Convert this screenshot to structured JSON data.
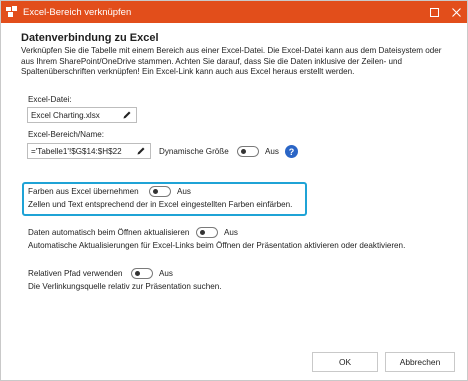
{
  "window": {
    "title": "Excel-Bereich verknüpfen",
    "accent_color": "#e24e1b"
  },
  "section": {
    "heading": "Datenverbindung zu Excel",
    "description": "Verknüpfen Sie die Tabelle mit einem Bereich aus einer Excel-Datei. Die Excel-Datei kann aus dem Dateisystem oder aus Ihrem SharePoint/OneDrive stammen. Achten Sie darauf, dass Sie die Daten inklusive der Zeilen- und Spaltenüberschriften verknüpfen! Ein Excel-Link kann auch aus Excel heraus erstellt werden."
  },
  "excel_file": {
    "label": "Excel-Datei:",
    "value": "Excel Charting.xlsx"
  },
  "excel_range": {
    "label": "Excel-Bereich/Name:",
    "value": "='Tabelle1'!$G$14:$H$22",
    "dynamic_size_label": "Dynamische Größe",
    "dynamic_size_state": "Aus"
  },
  "colors_option": {
    "label": "Farben aus Excel übernehmen",
    "state": "Aus",
    "description": "Zellen und Text entsprechend der in Excel eingestellten Farben einfärben.",
    "highlight_color": "#1fa3d6"
  },
  "auto_update_option": {
    "label": "Daten automatisch beim Öffnen aktualisieren",
    "state": "Aus",
    "description": "Automatische Aktualisierungen für Excel-Links beim Öffnen der Präsentation aktivieren oder deaktivieren."
  },
  "relative_path_option": {
    "label": "Relativen Pfad verwenden",
    "state": "Aus",
    "description": "Die Verlinkungsquelle relativ zur Präsentation suchen."
  },
  "buttons": {
    "ok": "OK",
    "cancel": "Abbrechen"
  },
  "icons": {
    "help": "?"
  }
}
